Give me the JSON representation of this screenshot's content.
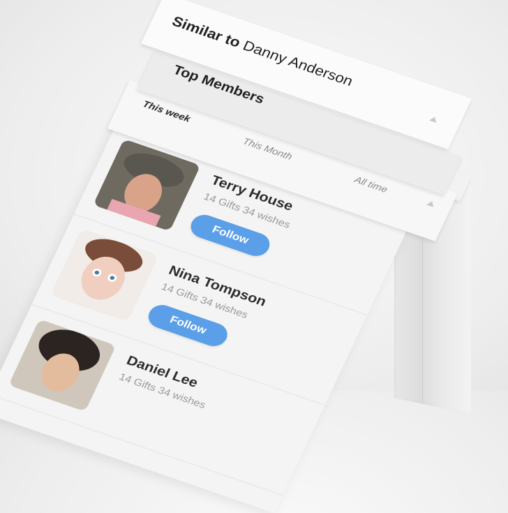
{
  "header": {
    "similar_prefix": "Similar to",
    "similar_name": "Danny Anderson",
    "top_members": "Top Members"
  },
  "tabs": [
    {
      "label": "This week",
      "active": true
    },
    {
      "label": "This Month",
      "active": false
    },
    {
      "label": "All time",
      "active": false
    }
  ],
  "members": [
    {
      "name": "Terry House",
      "stats": "14 Gifts 34 wishes",
      "follow": "Follow"
    },
    {
      "name": "Nina Tompson",
      "stats": "14 Gifts 34 wishes",
      "follow": "Follow"
    },
    {
      "name": "Daniel Lee",
      "stats": "14 Gifts 34 wishes"
    }
  ],
  "colors": {
    "accent": "#5a9fe8",
    "background": "#efefef",
    "card": "#f4f4f4"
  }
}
